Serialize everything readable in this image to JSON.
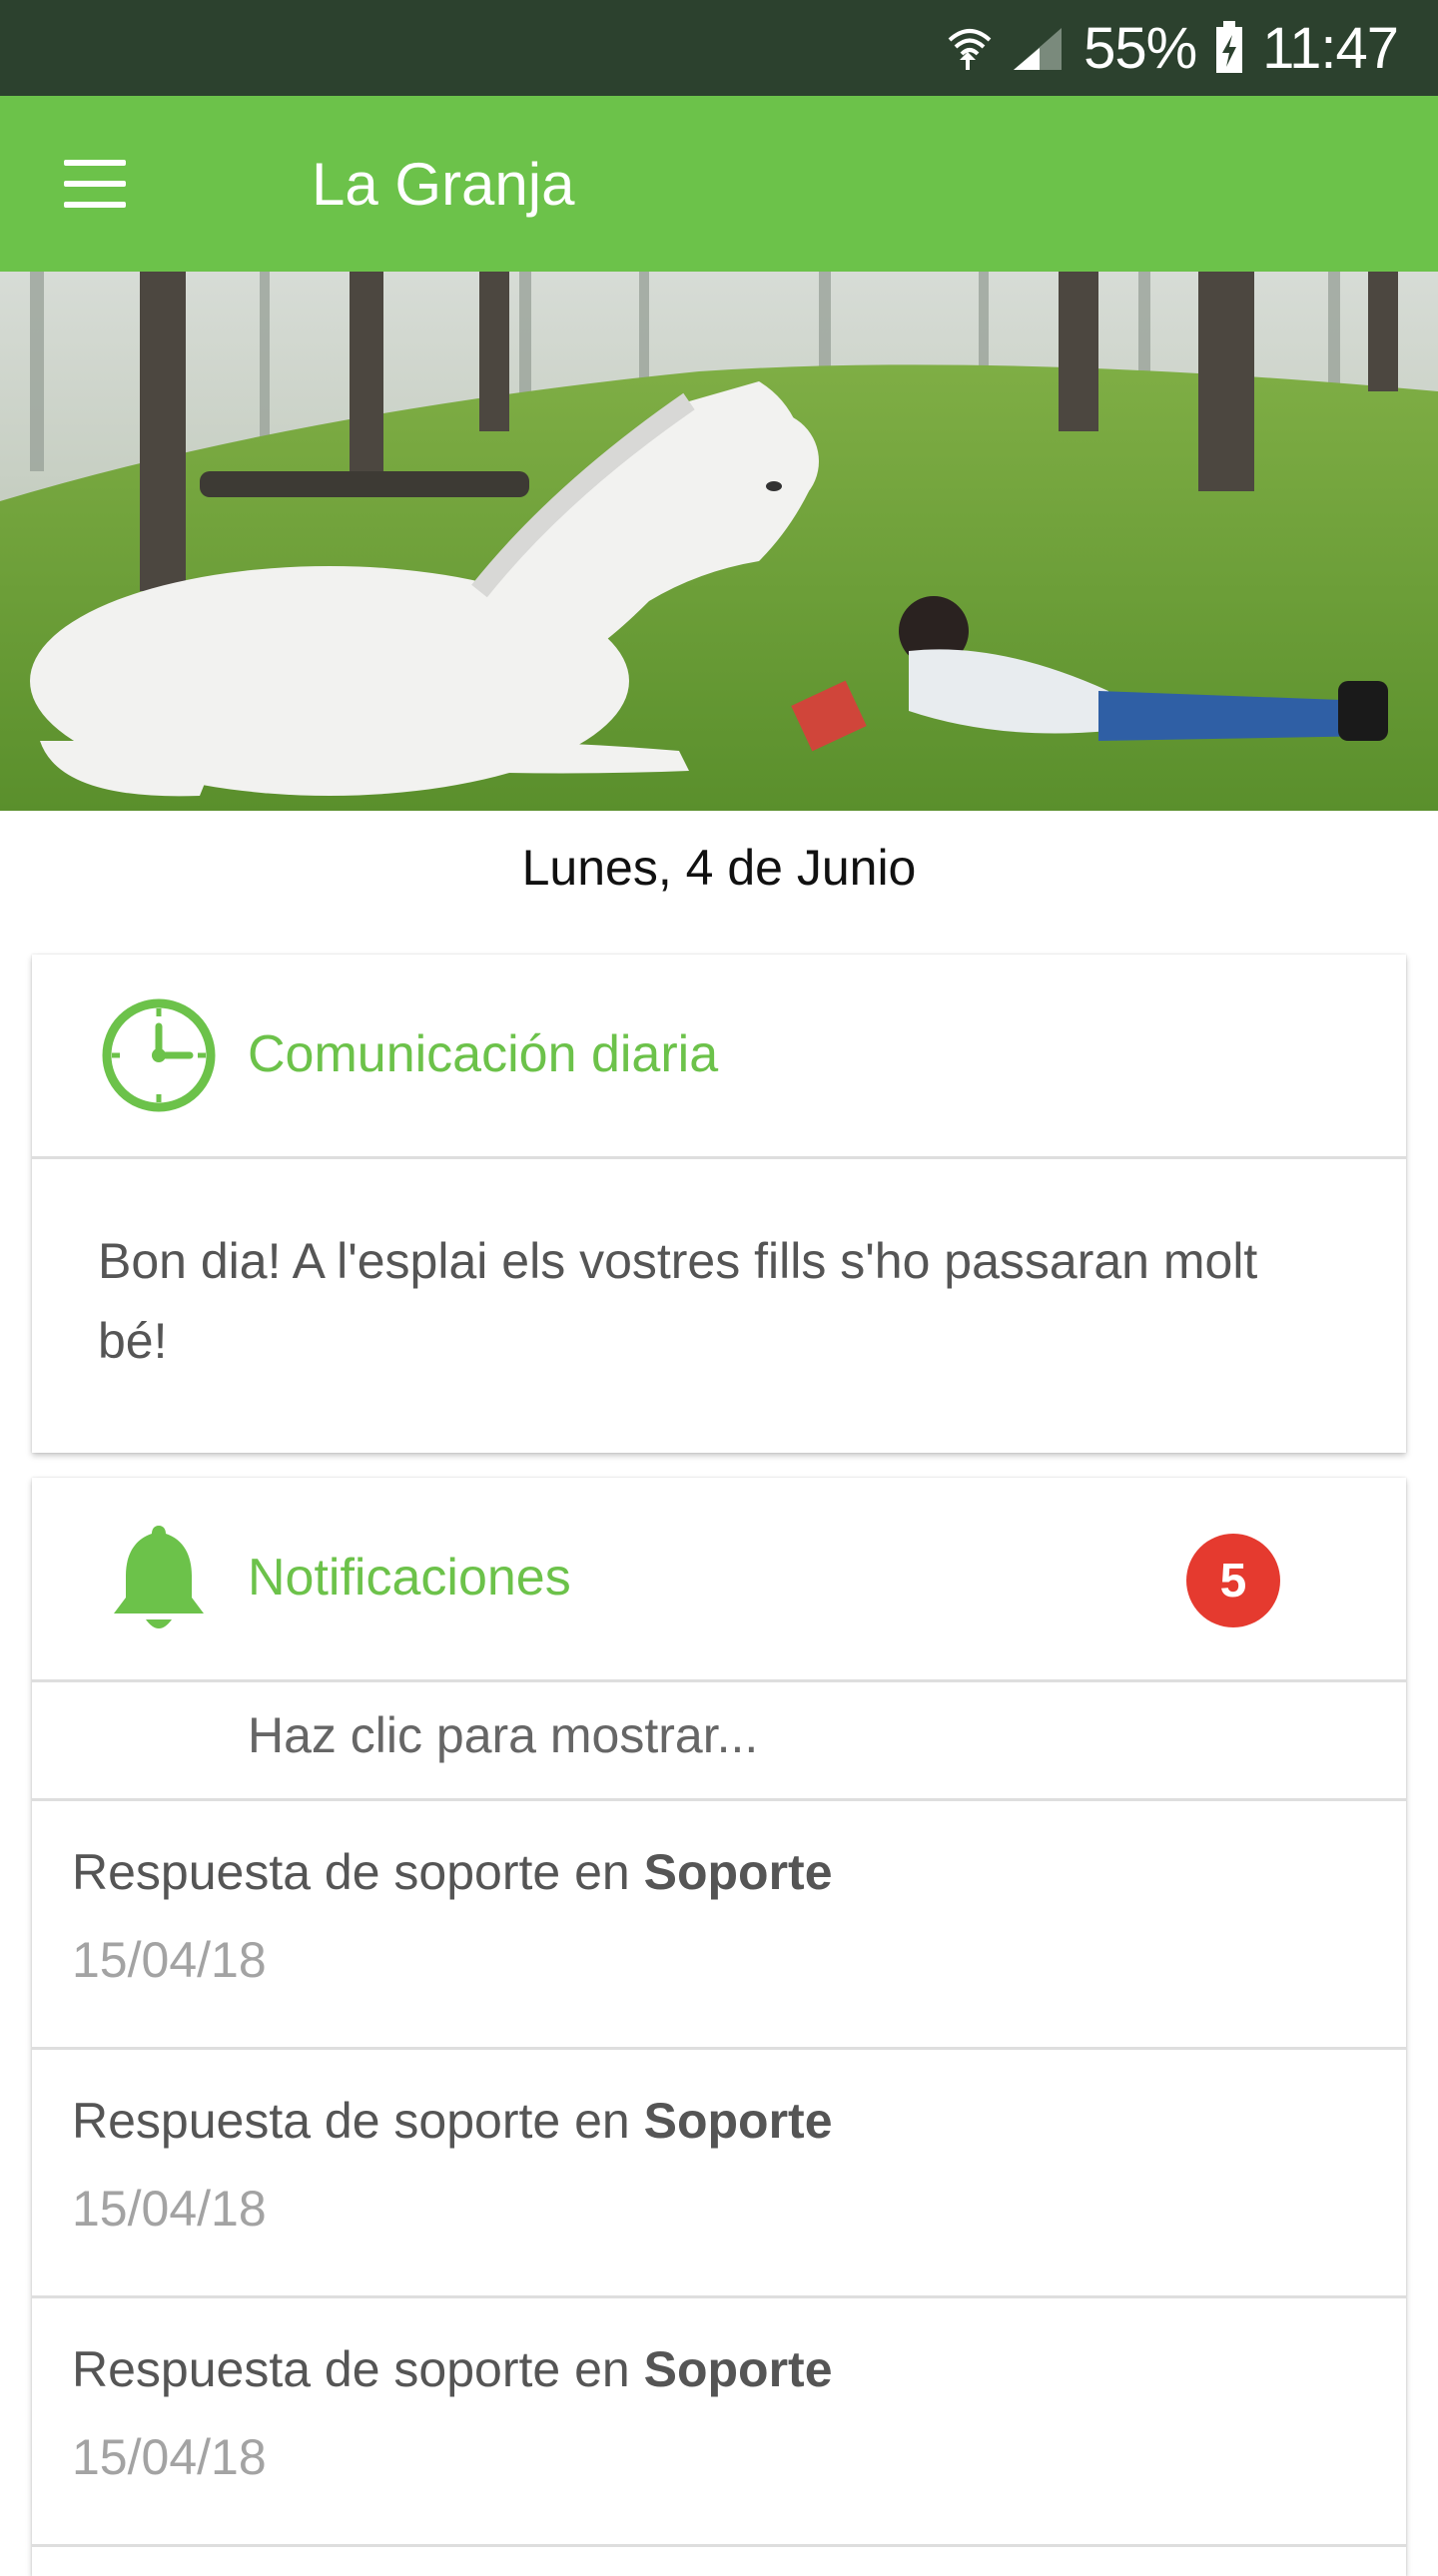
{
  "status_bar": {
    "battery": "55%",
    "time": "11:47",
    "icons": [
      "wifi-icon",
      "signal-icon",
      "battery-charging-icon"
    ]
  },
  "app_bar": {
    "menu_icon": "hamburger-menu-icon",
    "title": "La Granja"
  },
  "hero": {
    "description_icon": "farm-photo"
  },
  "date": "Lunes, 4 de Junio",
  "daily_card": {
    "icon": "clock-icon",
    "title": "Comunicación diaria",
    "message": "Bon dia! A l'esplai els vostres fills s'ho passaran molt bé!"
  },
  "notifications_card": {
    "icon": "bell-icon",
    "title": "Notificaciones",
    "badge_count": "5",
    "show_more": "Haz clic para mostrar...",
    "items": [
      {
        "prefix": "Respuesta de soporte en ",
        "channel": "Soporte",
        "date": "15/04/18"
      },
      {
        "prefix": "Respuesta de soporte en ",
        "channel": "Soporte",
        "date": "15/04/18"
      },
      {
        "prefix": "Respuesta de soporte en ",
        "channel": "Soporte",
        "date": "15/04/18"
      }
    ]
  },
  "colors": {
    "status_bar": "#2c412e",
    "app_bar": "#6cc24a",
    "accent": "#6cc24a",
    "badge": "#e53a2f"
  }
}
